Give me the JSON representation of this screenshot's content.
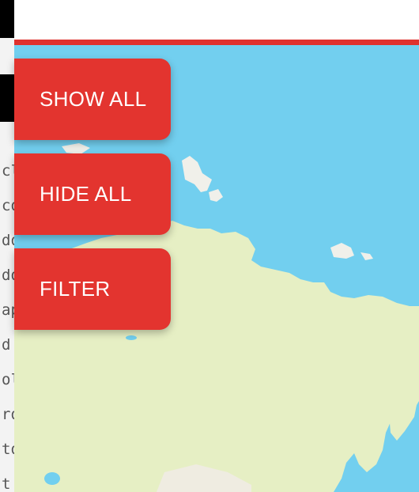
{
  "buttons": {
    "show_all": "SHOW ALL",
    "hide_all": "HIDE ALL",
    "filter": "FILTER"
  },
  "code_gutter": {
    "lines": [
      "cl",
      "co",
      "do",
      "do",
      "ap",
      "d:",
      "ol",
      "ro",
      "to",
      "t:"
    ]
  },
  "colors": {
    "accent": "#e0322e",
    "button": "#e3342f",
    "water": "#72cfef",
    "land": "#e6efc4"
  }
}
